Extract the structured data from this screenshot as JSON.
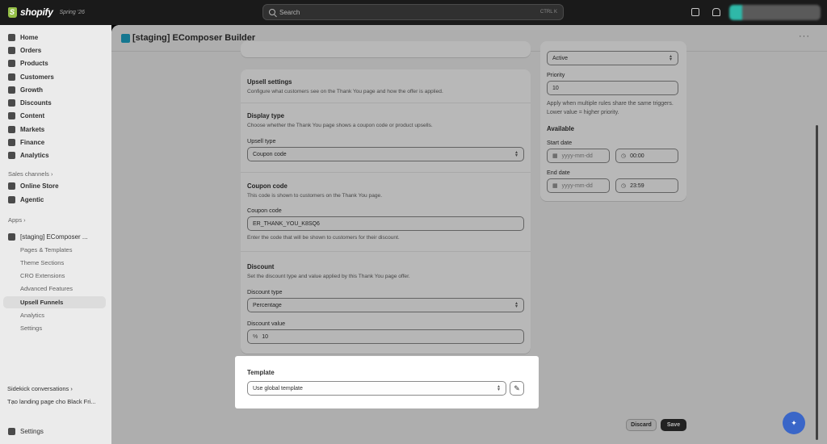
{
  "topbar": {
    "brand": "shopify",
    "edition": "Spring '26",
    "search_placeholder": "Search",
    "search_shortcut": "CTRL  K"
  },
  "sidebar": {
    "items": [
      {
        "label": "Home",
        "icon": "home-icon"
      },
      {
        "label": "Orders",
        "icon": "orders-icon"
      },
      {
        "label": "Products",
        "icon": "tag-icon"
      },
      {
        "label": "Customers",
        "icon": "person-icon"
      },
      {
        "label": "Growth",
        "icon": "growth-icon"
      },
      {
        "label": "Discounts",
        "icon": "discount-icon"
      },
      {
        "label": "Content",
        "icon": "content-icon"
      },
      {
        "label": "Markets",
        "icon": "globe-icon"
      },
      {
        "label": "Finance",
        "icon": "bank-icon"
      },
      {
        "label": "Analytics",
        "icon": "chart-icon"
      }
    ],
    "sales_channels_label": "Sales channels ›",
    "channels": [
      {
        "label": "Online Store",
        "icon": "store-icon"
      },
      {
        "label": "Agentic",
        "icon": "agent-icon"
      }
    ],
    "apps_label": "Apps ›",
    "app_name": "[staging] EComposer ...",
    "app_subitems": [
      "Pages & Templates",
      "Theme Sections",
      "CRO Extensions",
      "Advanced Features",
      "Upsell Funnels",
      "Analytics",
      "Settings"
    ],
    "sidekick_label": "Sidekick conversations ›",
    "sidekick_item": "Tạo landing page cho Black Fri...",
    "settings_label": "Settings"
  },
  "app": {
    "title": "[staging] EComposer Builder"
  },
  "upsell": {
    "title": "Upsell settings",
    "desc": "Configure what customers see on the Thank You page and how the offer is applied.",
    "display_type_title": "Display type",
    "display_type_desc": "Choose whether the Thank You page shows a coupon code or product upsells.",
    "upsell_type_label": "Upsell type",
    "upsell_type_value": "Coupon code",
    "coupon_title": "Coupon code",
    "coupon_desc": "This code is shown to customers on the Thank You page.",
    "coupon_label": "Coupon code",
    "coupon_value": "ER_THANK_YOU_K8SQ6",
    "coupon_help": "Enter the code that will be shown to customers for their discount.",
    "discount_title": "Discount",
    "discount_desc": "Set the discount type and value applied by this Thank You page offer.",
    "discount_type_label": "Discount type",
    "discount_type_value": "Percentage",
    "discount_value_label": "Discount value",
    "discount_prefix": "%",
    "discount_value": "10"
  },
  "template": {
    "title": "Template",
    "select_value": "Use global template"
  },
  "side": {
    "status_value": "Active",
    "priority_label": "Priority",
    "priority_value": "10",
    "priority_help": "Apply when multiple rules share the same triggers. Lower value = higher priority.",
    "available_title": "Available",
    "start_label": "Start date",
    "start_date_placeholder": "yyyy-mm-dd",
    "start_time": "00:00",
    "end_label": "End date",
    "end_date_placeholder": "yyyy-mm-dd",
    "end_time": "23:59"
  },
  "actions": {
    "discard": "Discard",
    "save": "Save"
  },
  "colors": {
    "brand_green": "#95bf47",
    "fab_blue": "#3a66c8",
    "app_icon": "#1ea5c8"
  }
}
